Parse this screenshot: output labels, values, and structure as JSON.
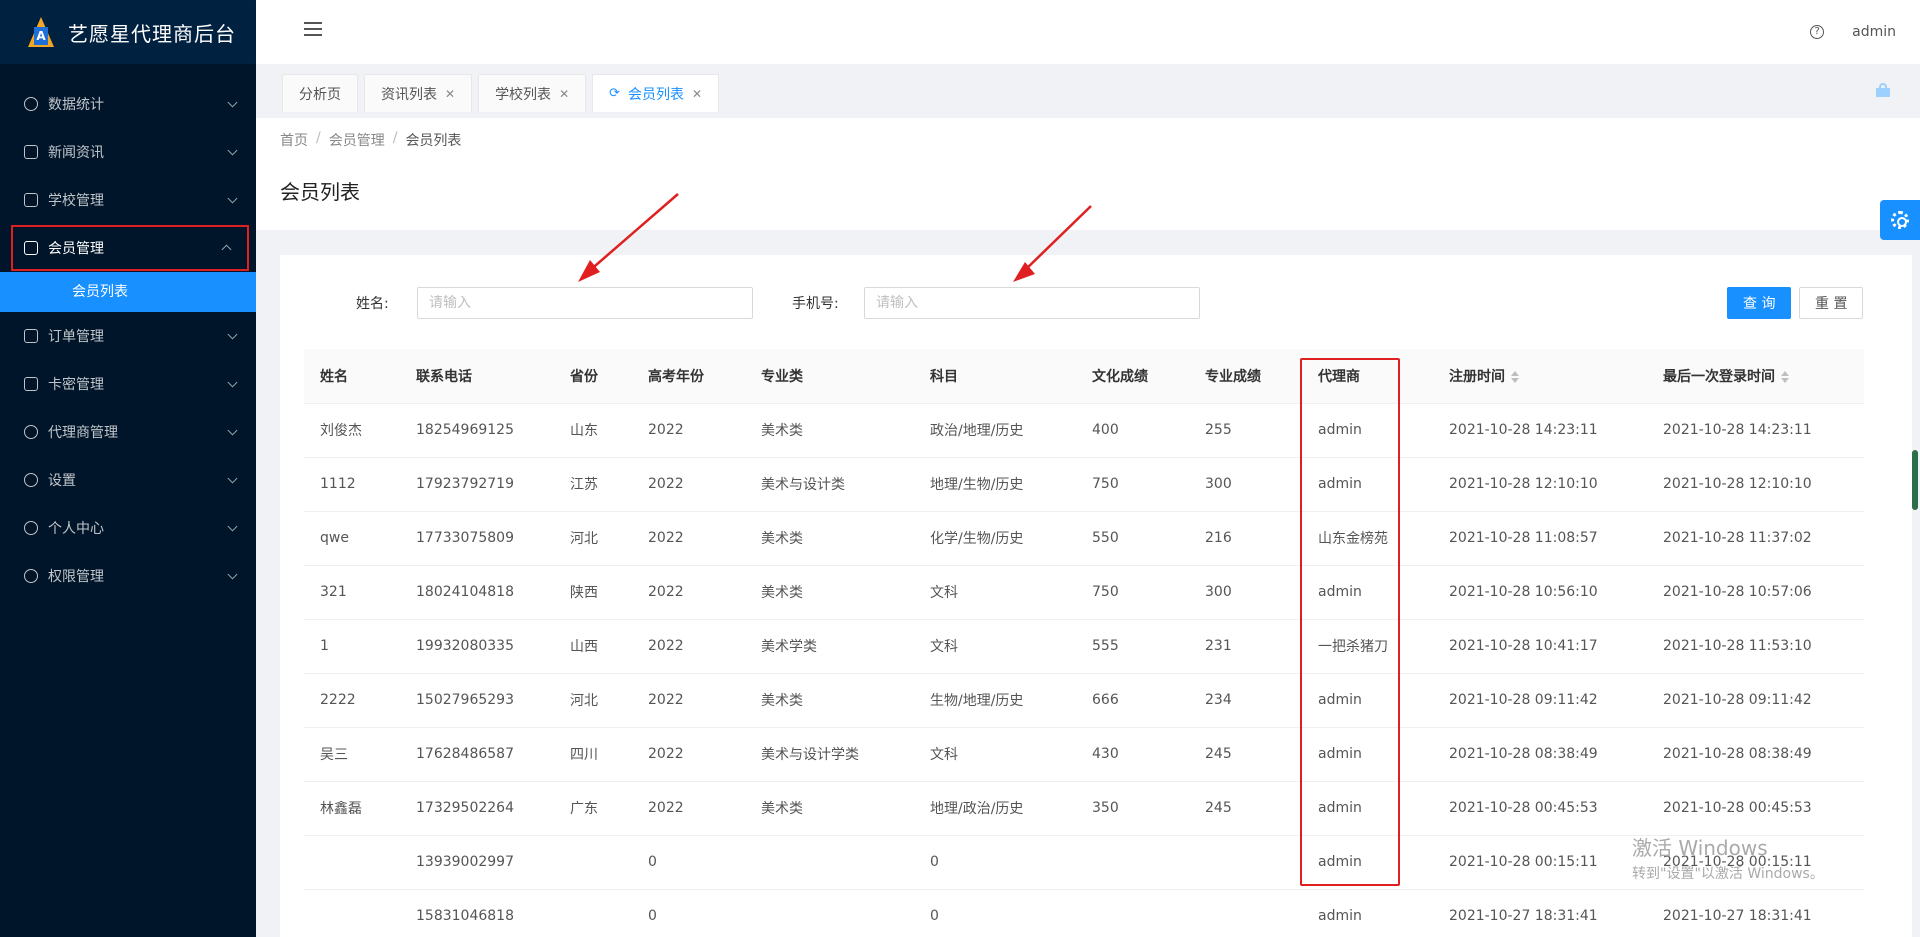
{
  "app": {
    "title": "艺愿星代理商后台"
  },
  "sidebar": {
    "items": [
      {
        "label": "数据统计",
        "icon": "dashboard-icon"
      },
      {
        "label": "新闻资讯",
        "icon": "news-icon"
      },
      {
        "label": "学校管理",
        "icon": "book-icon"
      },
      {
        "label": "会员管理",
        "icon": "crown-icon",
        "open": true,
        "highlighted": true
      },
      {
        "label": "订单管理",
        "icon": "order-icon"
      },
      {
        "label": "卡密管理",
        "icon": "card-icon"
      },
      {
        "label": "代理商管理",
        "icon": "team-icon"
      },
      {
        "label": "设置",
        "icon": "gear-icon"
      },
      {
        "label": "个人中心",
        "icon": "user-icon"
      },
      {
        "label": "权限管理",
        "icon": "permission-icon"
      }
    ],
    "submenu": {
      "label": "会员列表",
      "active": true
    }
  },
  "header": {
    "user": "admin",
    "help_icon": "question-circle-icon"
  },
  "tabs": [
    {
      "label": "分析页",
      "closable": false,
      "active": false
    },
    {
      "label": "资讯列表",
      "closable": true,
      "active": false
    },
    {
      "label": "学校列表",
      "closable": true,
      "active": false
    },
    {
      "label": "会员列表",
      "closable": true,
      "active": true
    }
  ],
  "breadcrumb": [
    "首页",
    "会员管理",
    "会员列表"
  ],
  "page_title": "会员列表",
  "search": {
    "name_label": "姓名:",
    "name_placeholder": "请输入",
    "name_value": "",
    "phone_label": "手机号:",
    "phone_placeholder": "请输入",
    "phone_value": "",
    "query_button": "查 询",
    "reset_button": "重 置"
  },
  "table": {
    "columns": [
      "姓名",
      "联系电话",
      "省份",
      "高考年份",
      "专业类",
      "科目",
      "文化成绩",
      "专业成绩",
      "代理商",
      "注册时间",
      "最后一次登录时间"
    ],
    "rows": [
      [
        "刘俊杰",
        "18254969125",
        "山东",
        "2022",
        "美术类",
        "政治/地理/历史",
        "400",
        "255",
        "admin",
        "2021-10-28 14:23:11",
        "2021-10-28 14:23:11"
      ],
      [
        "1112",
        "17923792719",
        "江苏",
        "2022",
        "美术与设计类",
        "地理/生物/历史",
        "750",
        "300",
        "admin",
        "2021-10-28 12:10:10",
        "2021-10-28 12:10:10"
      ],
      [
        "qwe",
        "17733075809",
        "河北",
        "2022",
        "美术类",
        "化学/生物/历史",
        "550",
        "216",
        "山东金榜苑",
        "2021-10-28 11:08:57",
        "2021-10-28 11:37:02"
      ],
      [
        "321",
        "18024104818",
        "陕西",
        "2022",
        "美术类",
        "文科",
        "750",
        "300",
        "admin",
        "2021-10-28 10:56:10",
        "2021-10-28 10:57:06"
      ],
      [
        "1",
        "19932080335",
        "山西",
        "2022",
        "美术学类",
        "文科",
        "555",
        "231",
        "一把杀猪刀",
        "2021-10-28 10:41:17",
        "2021-10-28 11:53:10"
      ],
      [
        "2222",
        "15027965293",
        "河北",
        "2022",
        "美术类",
        "生物/地理/历史",
        "666",
        "234",
        "admin",
        "2021-10-28 09:11:42",
        "2021-10-28 09:11:42"
      ],
      [
        "吴三",
        "17628486587",
        "四川",
        "2022",
        "美术与设计学类",
        "文科",
        "430",
        "245",
        "admin",
        "2021-10-28 08:38:49",
        "2021-10-28 08:38:49"
      ],
      [
        "林鑫磊",
        "17329502264",
        "广东",
        "2022",
        "美术类",
        "地理/政治/历史",
        "350",
        "245",
        "admin",
        "2021-10-28 00:45:53",
        "2021-10-28 00:45:53"
      ],
      [
        "",
        "13939002997",
        "",
        "0",
        "",
        "0",
        "",
        "",
        "admin",
        "2021-10-28 00:15:11",
        "2021-10-28 00:15:11"
      ],
      [
        "",
        "15831046818",
        "",
        "0",
        "",
        "0",
        "",
        "",
        "admin",
        "2021-10-27 18:31:41",
        "2021-10-27 18:31:41"
      ]
    ]
  },
  "watermark": {
    "line1": "激活 Windows",
    "line2": "转到\"设置\"以激活 Windows。"
  },
  "colors": {
    "sidebar_bg": "#001529",
    "primary": "#1890ff",
    "annotation_red": "#e02020"
  }
}
